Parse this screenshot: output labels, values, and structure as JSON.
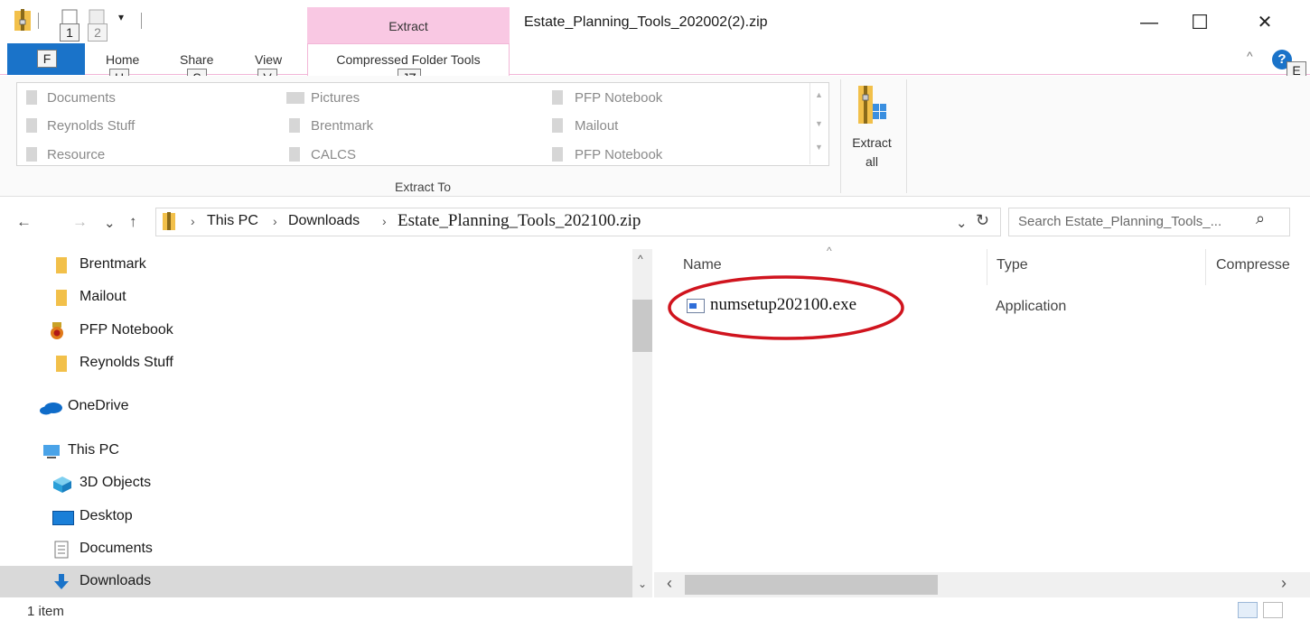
{
  "window": {
    "title": "Estate_Planning_Tools_202002(2).zip",
    "minimize": "—",
    "maximize": "☐",
    "close": "✕"
  },
  "qat": {
    "keytip_1": "1",
    "keytip_2": "2",
    "caret": "▾"
  },
  "ribbon_tabs": {
    "context_group": "Extract",
    "file": {
      "keytip": "F"
    },
    "home": {
      "label": "Home",
      "keytip": "H"
    },
    "share": {
      "label": "Share",
      "keytip": "S"
    },
    "view": {
      "label": "View",
      "keytip": "V"
    },
    "compressed": {
      "label": "Compressed Folder Tools",
      "keytip": "JZ"
    },
    "help_keytip": "E",
    "collapse": "^",
    "help": "?"
  },
  "extract_to": {
    "group_label": "Extract To",
    "items": [
      "Documents",
      "Reynolds Stuff",
      "Resource",
      "Pictures",
      "Brentmark",
      "CALCS",
      "PFP Notebook",
      "Mailout",
      "PFP Notebook"
    ],
    "extract_all": "Extract all"
  },
  "address": {
    "back": "←",
    "forward": "→",
    "recent": "⌄",
    "up": "↑",
    "crumbs": [
      "This PC",
      "Downloads",
      "Estate_Planning_Tools_202100.zip"
    ],
    "sep": "›",
    "dropdown": "⌄",
    "refresh": "↻",
    "search_placeholder": "Search Estate_Planning_Tools_...",
    "search_icon": "⌕"
  },
  "nav": {
    "items": [
      "Brentmark",
      "Mailout",
      "PFP Notebook",
      "Reynolds Stuff",
      "OneDrive",
      "This PC",
      "3D Objects",
      "Desktop",
      "Documents",
      "Downloads"
    ],
    "scroll_up": "^",
    "scroll_down": "⌄"
  },
  "content": {
    "columns": [
      "Name",
      "Type",
      "Compresse"
    ],
    "sort_caret": "^",
    "rows": [
      {
        "name": "numsetup202100.exe",
        "type": "Application"
      }
    ],
    "scroll_left": "‹",
    "scroll_right": "›"
  },
  "status": {
    "count": "1 item"
  },
  "colors": {
    "file_tab": "#1a73c9",
    "context_tab": "#f9c8e3",
    "annotation": "#d0141e",
    "selected_row": "#d9d9d9"
  }
}
